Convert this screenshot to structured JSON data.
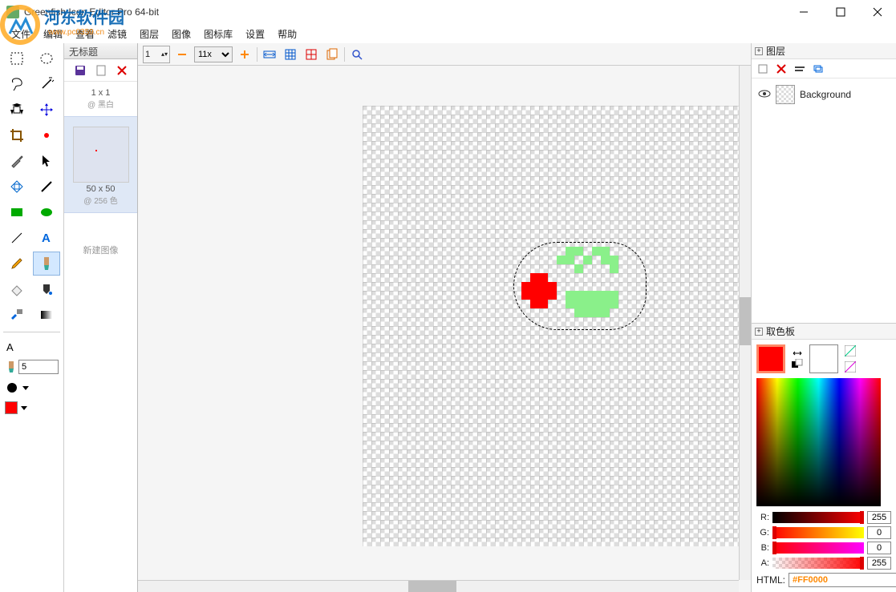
{
  "window": {
    "title": "Greenfish Icon Editor Pro 64-bit"
  },
  "menu": {
    "items": [
      "文件",
      "编辑",
      "查看",
      "滤镜",
      "图层",
      "图像",
      "图标库",
      "设置",
      "帮助"
    ]
  },
  "doc_tab": {
    "title": "无标题"
  },
  "doc_panel": {
    "thumb1_size": "1 x 1",
    "thumb1_mode": "@ 黑白",
    "thumb2_size": "50 x 50",
    "thumb2_mode": "@ 256 色",
    "new_label": "新建图像"
  },
  "canvas_toolbar": {
    "zoom": "11x",
    "page": "1"
  },
  "tool_options": {
    "brush_size": "5"
  },
  "layers": {
    "title": "图层",
    "items": [
      "Background"
    ]
  },
  "color_panel": {
    "title": "取色板",
    "r": "255",
    "g": "0",
    "b": "0",
    "a": "255",
    "html_label": "HTML:",
    "html_value": "#FF0000",
    "r_label": "R:",
    "g_label": "G:",
    "b_label": "B:",
    "a_label": "A:",
    "primary": "#FF0000",
    "secondary": "#FFFFFF"
  },
  "watermark": {
    "text": "河东软件园",
    "url": "www.pc0359.cn"
  }
}
